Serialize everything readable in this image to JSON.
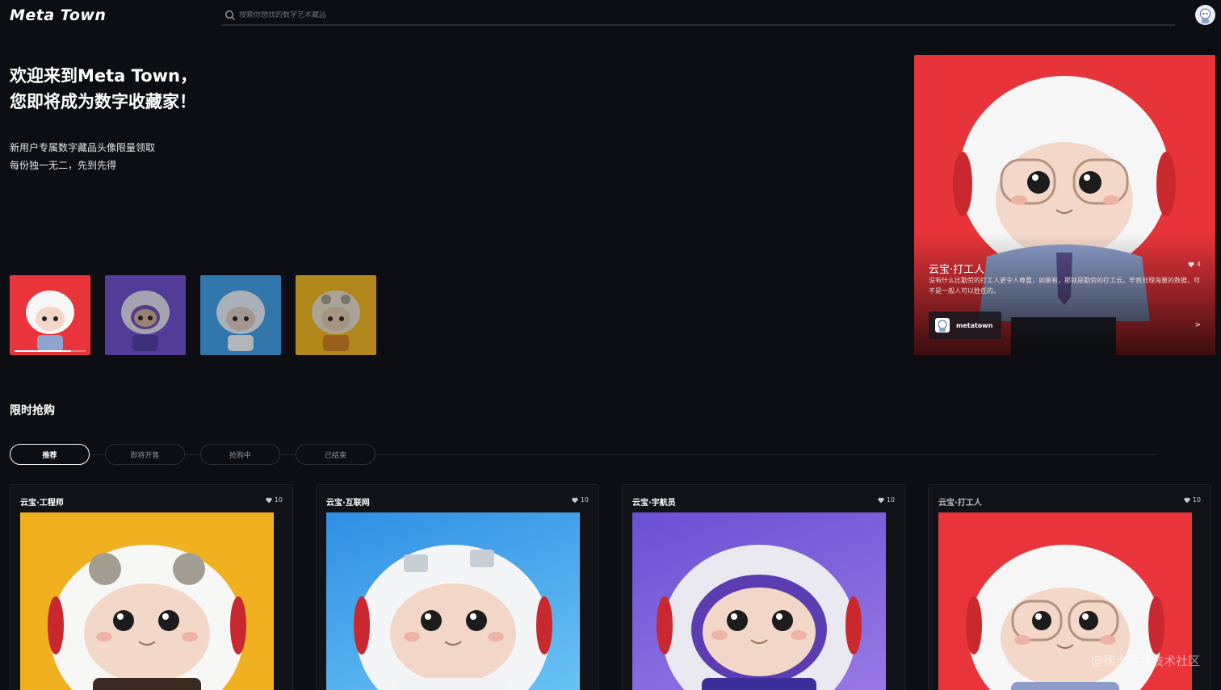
{
  "header": {
    "logo": "Meta Town",
    "search_placeholder": "搜索你想找的数字艺术藏品"
  },
  "hero": {
    "title_line1": "欢迎来到Meta Town，",
    "title_line2": "您即将成为数字收藏家！",
    "sub_line1": "新用户专属数字藏品头像限量领取",
    "sub_line2": "每份独一无二，先到先得",
    "thumb_progress": 0.8
  },
  "feature": {
    "name": "云宝·打工人",
    "likes": "4",
    "description": "没有什么比勤劳的打工人更令人尊重，如果有，那就是勤劳的打工云。毕竟处理海量的数据，可不是一般人可以胜任的。",
    "creator": "metatown",
    "arrow": ">"
  },
  "section": {
    "title": "限时抢购",
    "tabs": [
      {
        "label": "推荐"
      },
      {
        "label": "即将开售"
      },
      {
        "label": "抢购中"
      },
      {
        "label": "已结束"
      }
    ]
  },
  "cards": [
    {
      "name": "云宝·工程师",
      "likes": "10",
      "color": "#f0b020"
    },
    {
      "name": "云宝·互联网",
      "likes": "10",
      "color": "#3aa4ec"
    },
    {
      "name": "云宝·宇航员",
      "likes": "10",
      "color": "#7a5ad8"
    },
    {
      "name": "云宝·打工人",
      "likes": "10",
      "color": "#e8343a"
    }
  ],
  "watermark": "@稀土掘金技术社区"
}
